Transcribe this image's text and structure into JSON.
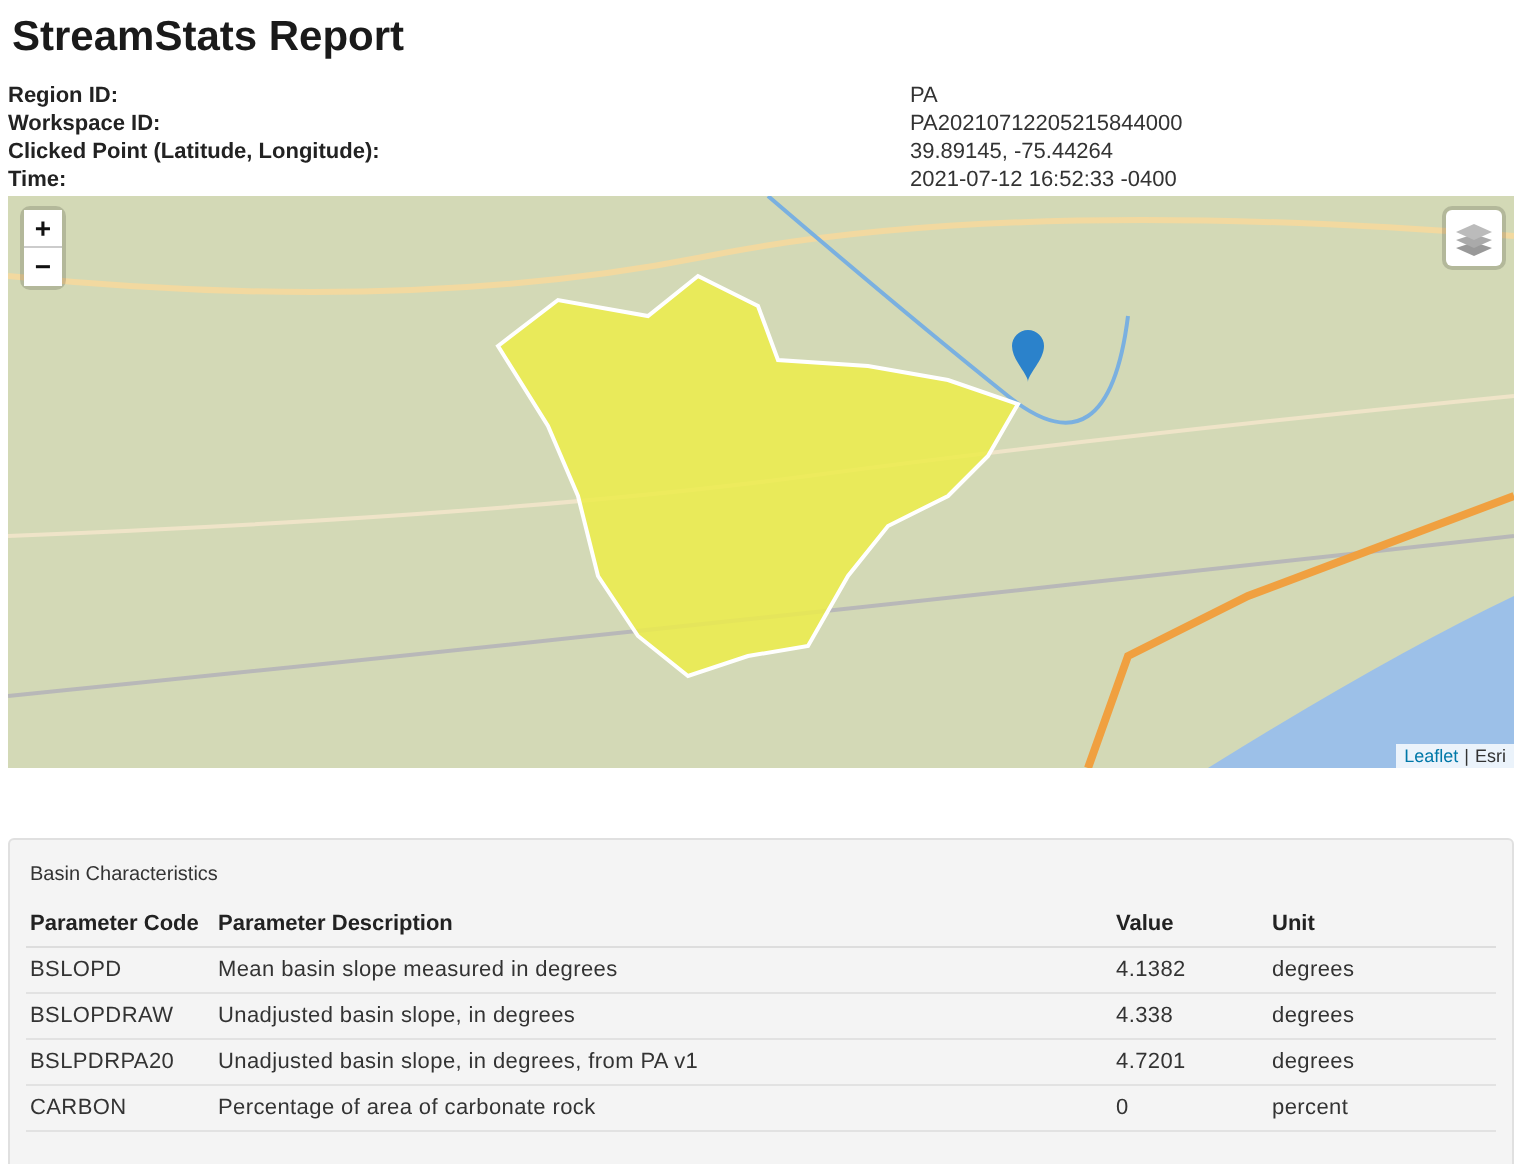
{
  "title": "StreamStats Report",
  "info": [
    {
      "label": "Region ID:",
      "value": "PA"
    },
    {
      "label": "Workspace ID:",
      "value": "PA20210712205215844000"
    },
    {
      "label": "Clicked Point (Latitude, Longitude):",
      "value": "39.89145, -75.44264"
    },
    {
      "label": "Time:",
      "value": "2021-07-12 16:52:33 -0400"
    }
  ],
  "map": {
    "zoom_in": "+",
    "zoom_out": "−",
    "attribution_link": "Leaflet",
    "attribution_sep": "|",
    "attribution_source": "Esri"
  },
  "basin": {
    "heading": "Basin Characteristics",
    "columns": [
      "Parameter Code",
      "Parameter Description",
      "Value",
      "Unit"
    ],
    "rows": [
      [
        "BSLOPD",
        "Mean basin slope measured in degrees",
        "4.1382",
        "degrees"
      ],
      [
        "BSLOPDRAW",
        "Unadjusted basin slope, in degrees",
        "4.338",
        "degrees"
      ],
      [
        "BSLPDRPA20",
        "Unadjusted basin slope, in degrees, from PA v1",
        "4.7201",
        "degrees"
      ],
      [
        "CARBON",
        "Percentage of area of carbonate rock",
        "0",
        "percent"
      ]
    ]
  }
}
